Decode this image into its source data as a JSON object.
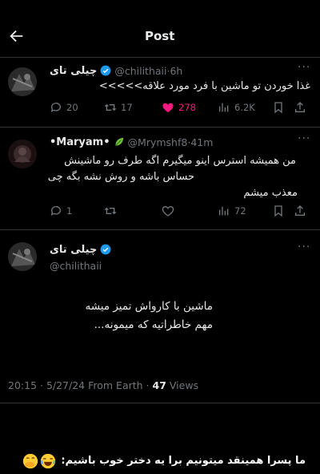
{
  "header": {
    "title": "Post"
  },
  "tweet1": {
    "name": "چیلی تای",
    "handle": "@chilithaii",
    "time": "6h",
    "text": "غذا خوردن تو ماشین با فرد مورد علاقه>>>>>",
    "replies": "20",
    "retweets": "17",
    "likes": "278",
    "views": "6.2K"
  },
  "reply": {
    "name": "•Maryam•",
    "handle": "@Mrymshf8",
    "time": "41m",
    "lines": [
      "من همیشه استرس اینو میگیرم اگه طرف رو ماشینش",
      "حساس باشه و روش نشه بگه چی",
      "معذب میشم"
    ],
    "replies": "1",
    "views": "72"
  },
  "tweet2": {
    "name": "چیلی تای",
    "handle": "@chilithaii",
    "lines": [
      "ماشین با کارواش تمیز میشه",
      "مهم خاطراتیه که میمونه..."
    ],
    "timestamp": "20:15 · 5/27/24 From Earth · ",
    "views_count": "47",
    "views_label": " Views"
  },
  "caption": {
    "text": "ما پسرا همینقد میتونیم برا یه دختر خوب باشیم:"
  },
  "colors": {
    "accent": "#1d9bf0",
    "like": "#f91880",
    "muted": "#71767b",
    "text": "#e7e9ea",
    "bg": "#000000"
  },
  "icons": [
    "back-arrow-icon",
    "verified-icon",
    "reply-icon",
    "retweet-icon",
    "heart-icon",
    "views-icon",
    "bookmark-icon",
    "share-icon",
    "more-icon",
    "leaf-emoji",
    "laughing-emoji",
    "hand-over-mouth-emoji"
  ]
}
